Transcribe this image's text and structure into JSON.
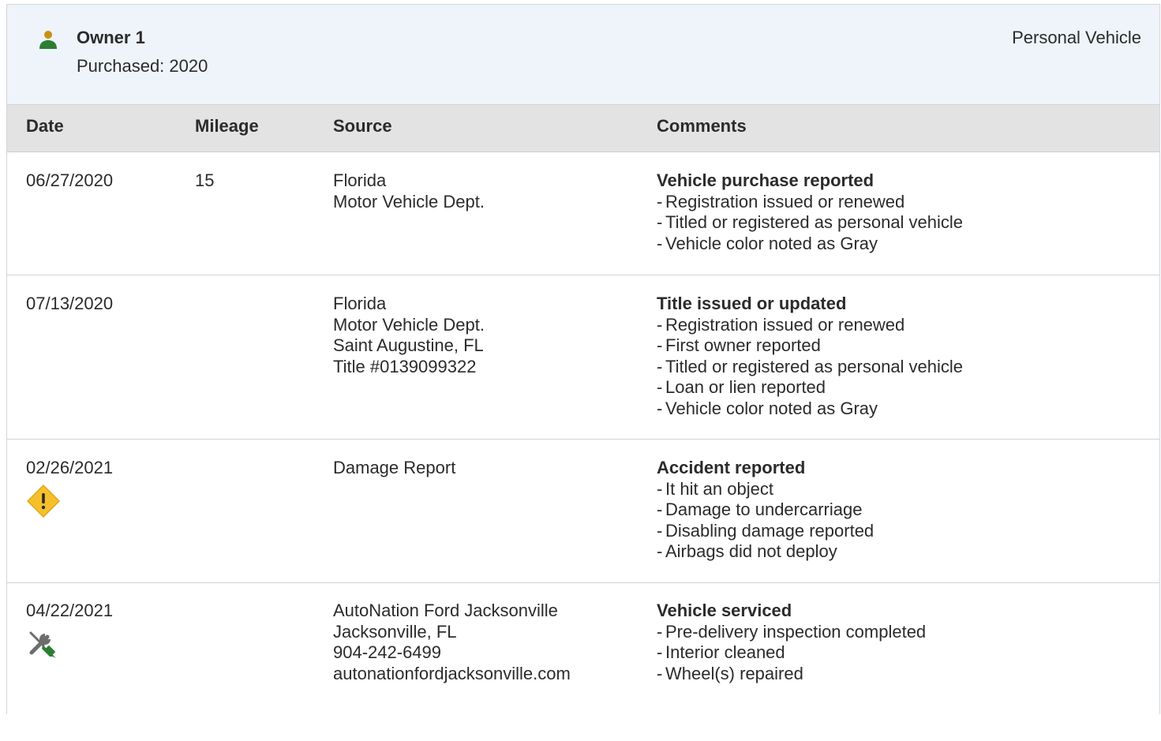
{
  "owner": {
    "title": "Owner 1",
    "purchased": "Purchased: 2020",
    "type": "Personal Vehicle",
    "icon": "person-icon",
    "icon_colors": {
      "head": "#c8900f",
      "body": "#2e7d32"
    }
  },
  "table": {
    "headers": {
      "date": "Date",
      "mileage": "Mileage",
      "source": "Source",
      "comments": "Comments"
    },
    "rows": [
      {
        "date": "06/27/2020",
        "mileage": "15",
        "source": [
          "Florida",
          "Motor Vehicle Dept."
        ],
        "comment_title": "Vehicle purchase reported",
        "comments": [
          "Registration issued or renewed",
          "Titled or registered as personal vehicle",
          "Vehicle color noted as Gray"
        ]
      },
      {
        "date": "07/13/2020",
        "mileage": "",
        "source": [
          "Florida",
          "Motor Vehicle Dept.",
          "Saint Augustine, FL",
          "Title #0139099322"
        ],
        "comment_title": "Title issued or updated",
        "comments": [
          "Registration issued or renewed",
          "First owner reported",
          "Titled or registered as personal vehicle",
          "Loan or lien reported",
          "Vehicle color noted as Gray"
        ]
      },
      {
        "date": "02/26/2021",
        "mileage": "",
        "icon": "warning-icon",
        "icon_color": "#f5c02c",
        "source": [
          "Damage Report"
        ],
        "comment_title": "Accident reported",
        "comments": [
          "It hit an object",
          "Damage to undercarriage",
          "Disabling damage reported",
          "Airbags did not deploy"
        ]
      },
      {
        "date": "04/22/2021",
        "mileage": "",
        "icon": "service-tools-icon",
        "icon_colors": {
          "wrench": "#6d6d6d",
          "screwdriver": "#2e7d32"
        },
        "source": [
          "AutoNation Ford Jacksonville",
          "Jacksonville, FL",
          "904-242-6499",
          "autonationfordjacksonville.com"
        ],
        "comment_title": "Vehicle serviced",
        "comments": [
          "Pre-delivery inspection completed",
          "Interior cleaned",
          "Wheel(s) repaired"
        ]
      }
    ]
  }
}
